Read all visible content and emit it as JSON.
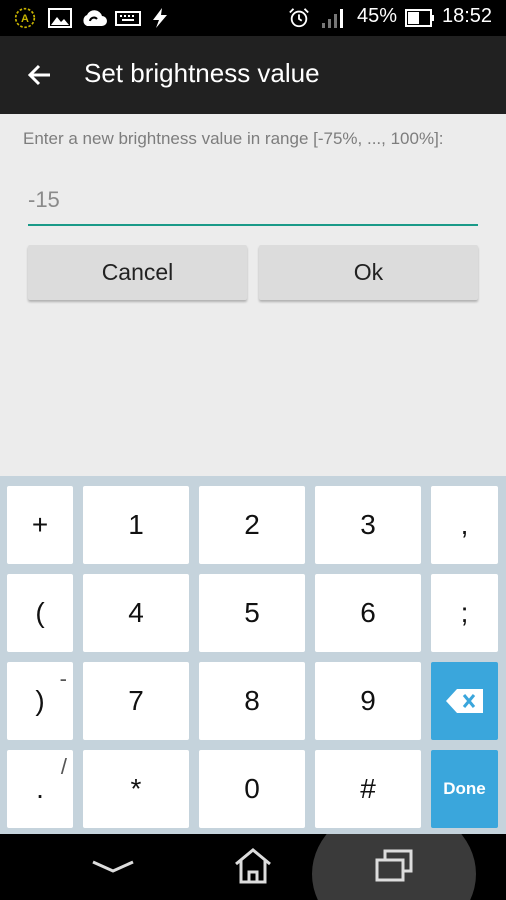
{
  "status_bar": {
    "icons": [
      "autostart-icon",
      "image-icon",
      "cloud-sync-icon",
      "keyboard-icon",
      "flash-icon",
      "alarm-icon",
      "signal-icon",
      "battery-icon"
    ],
    "battery_percent": "45%",
    "time": "18:52"
  },
  "toolbar": {
    "title": "Set brightness value"
  },
  "dialog": {
    "prompt": "Enter a new brightness value in range [-75%, ..., 100%]:",
    "value": "-15",
    "cancel_label": "Cancel",
    "ok_label": "Ok"
  },
  "keyboard": {
    "rows": [
      [
        {
          "label": "+",
          "sub": ""
        },
        {
          "label": "1",
          "sub": ""
        },
        {
          "label": "2",
          "sub": ""
        },
        {
          "label": "3",
          "sub": ""
        },
        {
          "label": ",",
          "sub": ""
        }
      ],
      [
        {
          "label": "(",
          "sub": ""
        },
        {
          "label": "4",
          "sub": ""
        },
        {
          "label": "5",
          "sub": ""
        },
        {
          "label": "6",
          "sub": ""
        },
        {
          "label": ";",
          "sub": ""
        }
      ],
      [
        {
          "label": ")",
          "sub": "-"
        },
        {
          "label": "7",
          "sub": ""
        },
        {
          "label": "8",
          "sub": ""
        },
        {
          "label": "9",
          "sub": ""
        },
        {
          "label": "",
          "sub": "",
          "icon": "backspace-icon"
        }
      ],
      [
        {
          "label": ".",
          "sub": "/"
        },
        {
          "label": "*",
          "sub": ""
        },
        {
          "label": "0",
          "sub": ""
        },
        {
          "label": "#",
          "sub": ""
        },
        {
          "label": "Done",
          "sub": ""
        }
      ]
    ],
    "accent_color": "#3aa6dc"
  },
  "nav_bar": {
    "icons": [
      "hide-keyboard-icon",
      "home-icon",
      "recent-apps-icon"
    ]
  }
}
